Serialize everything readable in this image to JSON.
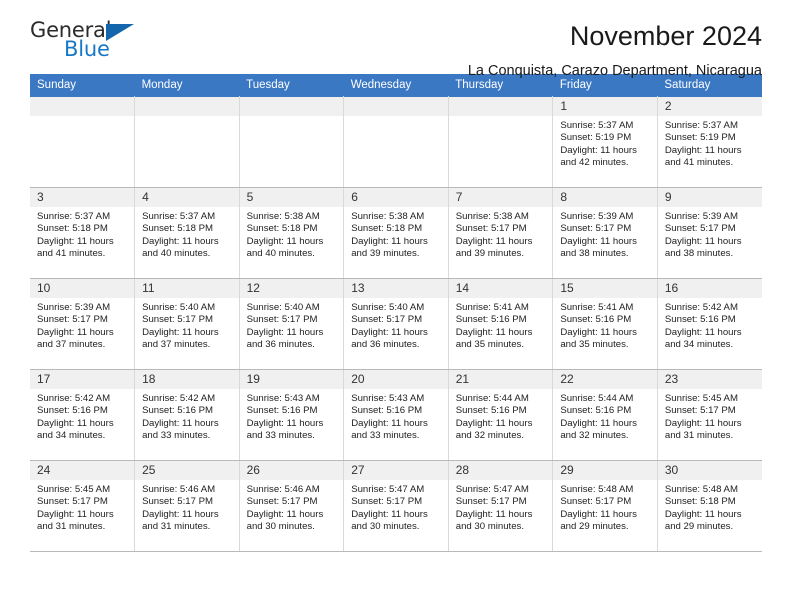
{
  "brand": {
    "name_top": "General",
    "name_bottom": "Blue",
    "accent_color": "#1878c8",
    "triangle_color": "#1366ab"
  },
  "header": {
    "title": "November 2024",
    "subtitle": "La Conquista, Carazo Department, Nicaragua",
    "header_bg_color": "#3b78c3"
  },
  "weekdays": [
    "Sunday",
    "Monday",
    "Tuesday",
    "Wednesday",
    "Thursday",
    "Friday",
    "Saturday"
  ],
  "labels": {
    "sunrise_prefix": "Sunrise:",
    "sunset_prefix": "Sunset:",
    "daylight_prefix": "Daylight:"
  },
  "weeks": [
    [
      {
        "day": "",
        "empty": true
      },
      {
        "day": "",
        "empty": true
      },
      {
        "day": "",
        "empty": true
      },
      {
        "day": "",
        "empty": true
      },
      {
        "day": "",
        "empty": true
      },
      {
        "day": "1",
        "sunrise": "Sunrise: 5:37 AM",
        "sunset": "Sunset: 5:19 PM",
        "daylight": "Daylight: 11 hours and 42 minutes."
      },
      {
        "day": "2",
        "sunrise": "Sunrise: 5:37 AM",
        "sunset": "Sunset: 5:19 PM",
        "daylight": "Daylight: 11 hours and 41 minutes."
      }
    ],
    [
      {
        "day": "3",
        "sunrise": "Sunrise: 5:37 AM",
        "sunset": "Sunset: 5:18 PM",
        "daylight": "Daylight: 11 hours and 41 minutes."
      },
      {
        "day": "4",
        "sunrise": "Sunrise: 5:37 AM",
        "sunset": "Sunset: 5:18 PM",
        "daylight": "Daylight: 11 hours and 40 minutes."
      },
      {
        "day": "5",
        "sunrise": "Sunrise: 5:38 AM",
        "sunset": "Sunset: 5:18 PM",
        "daylight": "Daylight: 11 hours and 40 minutes."
      },
      {
        "day": "6",
        "sunrise": "Sunrise: 5:38 AM",
        "sunset": "Sunset: 5:18 PM",
        "daylight": "Daylight: 11 hours and 39 minutes."
      },
      {
        "day": "7",
        "sunrise": "Sunrise: 5:38 AM",
        "sunset": "Sunset: 5:17 PM",
        "daylight": "Daylight: 11 hours and 39 minutes."
      },
      {
        "day": "8",
        "sunrise": "Sunrise: 5:39 AM",
        "sunset": "Sunset: 5:17 PM",
        "daylight": "Daylight: 11 hours and 38 minutes."
      },
      {
        "day": "9",
        "sunrise": "Sunrise: 5:39 AM",
        "sunset": "Sunset: 5:17 PM",
        "daylight": "Daylight: 11 hours and 38 minutes."
      }
    ],
    [
      {
        "day": "10",
        "sunrise": "Sunrise: 5:39 AM",
        "sunset": "Sunset: 5:17 PM",
        "daylight": "Daylight: 11 hours and 37 minutes."
      },
      {
        "day": "11",
        "sunrise": "Sunrise: 5:40 AM",
        "sunset": "Sunset: 5:17 PM",
        "daylight": "Daylight: 11 hours and 37 minutes."
      },
      {
        "day": "12",
        "sunrise": "Sunrise: 5:40 AM",
        "sunset": "Sunset: 5:17 PM",
        "daylight": "Daylight: 11 hours and 36 minutes."
      },
      {
        "day": "13",
        "sunrise": "Sunrise: 5:40 AM",
        "sunset": "Sunset: 5:17 PM",
        "daylight": "Daylight: 11 hours and 36 minutes."
      },
      {
        "day": "14",
        "sunrise": "Sunrise: 5:41 AM",
        "sunset": "Sunset: 5:16 PM",
        "daylight": "Daylight: 11 hours and 35 minutes."
      },
      {
        "day": "15",
        "sunrise": "Sunrise: 5:41 AM",
        "sunset": "Sunset: 5:16 PM",
        "daylight": "Daylight: 11 hours and 35 minutes."
      },
      {
        "day": "16",
        "sunrise": "Sunrise: 5:42 AM",
        "sunset": "Sunset: 5:16 PM",
        "daylight": "Daylight: 11 hours and 34 minutes."
      }
    ],
    [
      {
        "day": "17",
        "sunrise": "Sunrise: 5:42 AM",
        "sunset": "Sunset: 5:16 PM",
        "daylight": "Daylight: 11 hours and 34 minutes."
      },
      {
        "day": "18",
        "sunrise": "Sunrise: 5:42 AM",
        "sunset": "Sunset: 5:16 PM",
        "daylight": "Daylight: 11 hours and 33 minutes."
      },
      {
        "day": "19",
        "sunrise": "Sunrise: 5:43 AM",
        "sunset": "Sunset: 5:16 PM",
        "daylight": "Daylight: 11 hours and 33 minutes."
      },
      {
        "day": "20",
        "sunrise": "Sunrise: 5:43 AM",
        "sunset": "Sunset: 5:16 PM",
        "daylight": "Daylight: 11 hours and 33 minutes."
      },
      {
        "day": "21",
        "sunrise": "Sunrise: 5:44 AM",
        "sunset": "Sunset: 5:16 PM",
        "daylight": "Daylight: 11 hours and 32 minutes."
      },
      {
        "day": "22",
        "sunrise": "Sunrise: 5:44 AM",
        "sunset": "Sunset: 5:16 PM",
        "daylight": "Daylight: 11 hours and 32 minutes."
      },
      {
        "day": "23",
        "sunrise": "Sunrise: 5:45 AM",
        "sunset": "Sunset: 5:17 PM",
        "daylight": "Daylight: 11 hours and 31 minutes."
      }
    ],
    [
      {
        "day": "24",
        "sunrise": "Sunrise: 5:45 AM",
        "sunset": "Sunset: 5:17 PM",
        "daylight": "Daylight: 11 hours and 31 minutes."
      },
      {
        "day": "25",
        "sunrise": "Sunrise: 5:46 AM",
        "sunset": "Sunset: 5:17 PM",
        "daylight": "Daylight: 11 hours and 31 minutes."
      },
      {
        "day": "26",
        "sunrise": "Sunrise: 5:46 AM",
        "sunset": "Sunset: 5:17 PM",
        "daylight": "Daylight: 11 hours and 30 minutes."
      },
      {
        "day": "27",
        "sunrise": "Sunrise: 5:47 AM",
        "sunset": "Sunset: 5:17 PM",
        "daylight": "Daylight: 11 hours and 30 minutes."
      },
      {
        "day": "28",
        "sunrise": "Sunrise: 5:47 AM",
        "sunset": "Sunset: 5:17 PM",
        "daylight": "Daylight: 11 hours and 30 minutes."
      },
      {
        "day": "29",
        "sunrise": "Sunrise: 5:48 AM",
        "sunset": "Sunset: 5:17 PM",
        "daylight": "Daylight: 11 hours and 29 minutes."
      },
      {
        "day": "30",
        "sunrise": "Sunrise: 5:48 AM",
        "sunset": "Sunset: 5:18 PM",
        "daylight": "Daylight: 11 hours and 29 minutes."
      }
    ]
  ]
}
